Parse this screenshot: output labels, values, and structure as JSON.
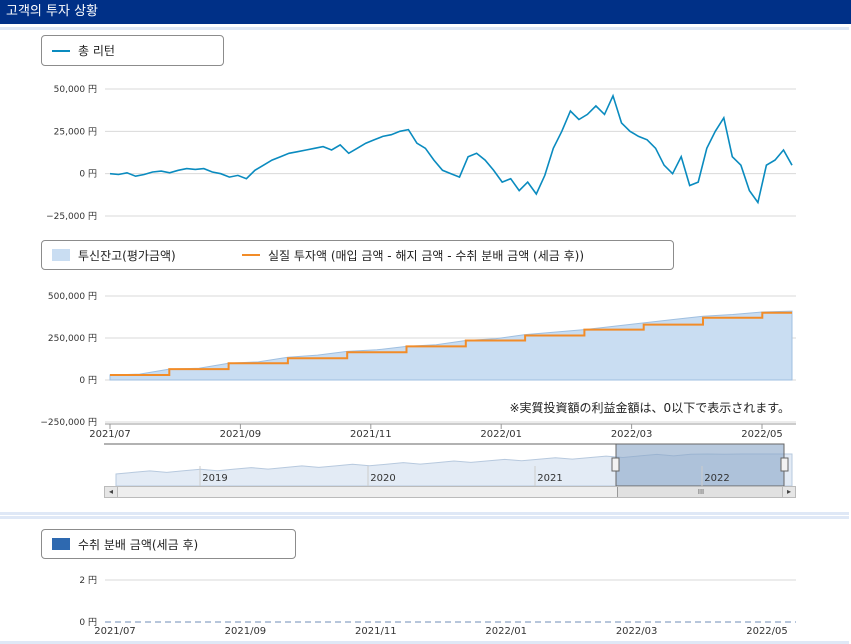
{
  "header": {
    "title": "고객의 투자 상황"
  },
  "colors": {
    "header_bg": "#003087",
    "total_return": "#0a8bbf",
    "balance_fill": "#c9ddf2",
    "balance_stroke": "#9fbfe0",
    "invest_line": "#f28c28",
    "dist_box": "#2e69b0",
    "nav_fill": "#8aa6c8"
  },
  "chart1": {
    "legend": {
      "total_return": "총 리턴"
    },
    "yticks": [
      "50,000 円",
      "25,000 円",
      "0 円",
      "−25,000 円"
    ]
  },
  "chart2": {
    "legend": {
      "balance": "투신잔고(평가금액)",
      "investment": "실질 투자액 (매입 금액 - 해지 금액 - 수취 분배 금액 (세금 후))"
    },
    "yticks": [
      "500,000 円",
      "250,000 円",
      "0 円",
      "−250,000 円"
    ],
    "note": "※実質投資額の利益金額は、0以下で表示されます。",
    "xticks": [
      "2021/07",
      "2021/09",
      "2021/11",
      "2022/01",
      "2022/03",
      "2022/05"
    ],
    "navigator_labels": [
      "2019",
      "2020",
      "2021",
      "2022"
    ],
    "scroll": {
      "left": "◂",
      "right": "▸",
      "grip": "III"
    }
  },
  "chart3": {
    "legend": {
      "distribution": "수취 분배 금액(세금 후)"
    },
    "yticks": [
      "2 円",
      "0 円"
    ],
    "xticks": [
      "2021/07",
      "2021/09",
      "2021/11",
      "2022/01",
      "2022/03",
      "2022/05"
    ]
  },
  "chart_data": [
    {
      "type": "line",
      "series": [
        {
          "name": "총 리턴",
          "x_start": "2021/07",
          "x_end": "2022/06",
          "values": [
            0,
            -500,
            500,
            -1500,
            -500,
            1000,
            1500,
            500,
            2000,
            3000,
            2500,
            3000,
            1000,
            0,
            -2000,
            -1000,
            -3000,
            2000,
            5000,
            8000,
            10000,
            12000,
            13000,
            14000,
            15000,
            16000,
            14000,
            17000,
            12000,
            15000,
            18000,
            20000,
            22000,
            23000,
            25000,
            26000,
            18000,
            15000,
            8000,
            2000,
            0,
            -2000,
            10000,
            12000,
            8000,
            2000,
            -5000,
            -3000,
            -10000,
            -5000,
            -12000,
            -1000,
            15000,
            25000,
            37000,
            32000,
            35000,
            40000,
            35000,
            46000,
            30000,
            25000,
            22000,
            20000,
            15000,
            5000,
            0,
            10000,
            -7000,
            -5000,
            15000,
            25000,
            33000,
            10000,
            5000,
            -10000,
            -17000,
            5000,
            8000,
            14000,
            5000
          ]
        }
      ],
      "yticks": [
        50000,
        25000,
        0,
        -25000
      ],
      "ylim": [
        -25000,
        50000
      ]
    },
    {
      "type": "area",
      "x_start": "2021/07",
      "x_end": "2022/06",
      "series": [
        {
          "name": "투신잔고(평가금액)",
          "values": [
            30000,
            35000,
            65000,
            70000,
            100000,
            108000,
            135000,
            148000,
            170000,
            180000,
            200000,
            210000,
            235000,
            245000,
            270000,
            285000,
            300000,
            320000,
            340000,
            360000,
            380000,
            390000,
            405000,
            410000
          ]
        },
        {
          "name": "실질 투자액 (매입 금액 - 해지 금액 - 수취 분배 금액 (세금 후))",
          "values": [
            30000,
            30000,
            65000,
            65000,
            100000,
            100000,
            130000,
            130000,
            165000,
            165000,
            200000,
            200000,
            235000,
            235000,
            265000,
            265000,
            300000,
            300000,
            330000,
            330000,
            370000,
            370000,
            400000,
            400000
          ]
        }
      ],
      "yticks": [
        500000,
        250000,
        0,
        -250000
      ],
      "ylim": [
        -250000,
        500000
      ]
    },
    {
      "type": "bar",
      "series": [
        {
          "name": "수취 분배 금액(세금 후)",
          "values": [
            0,
            0,
            0,
            0,
            0,
            0,
            0,
            0,
            0,
            0,
            0,
            0
          ]
        }
      ],
      "yticks": [
        2,
        0
      ],
      "ylim": [
        0,
        2
      ]
    }
  ]
}
